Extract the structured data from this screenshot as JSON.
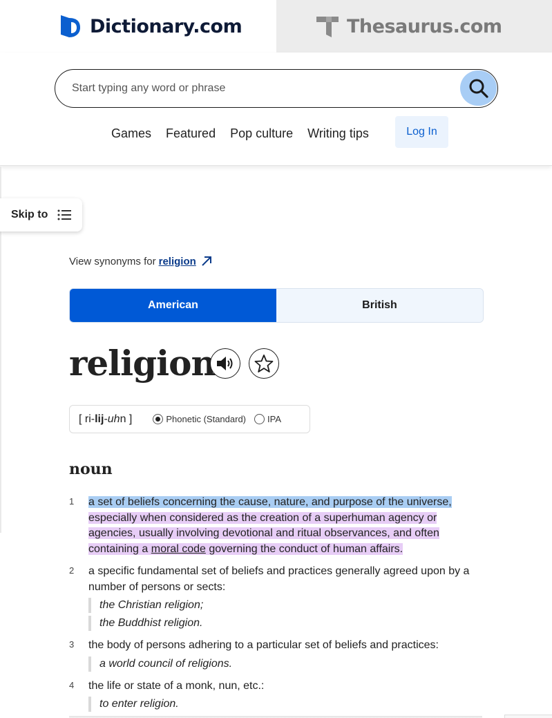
{
  "tabs": {
    "dictionary": "Dictionary.com",
    "thesaurus": "Thesaurus.com"
  },
  "search": {
    "placeholder": "Start typing any word or phrase"
  },
  "nav": {
    "items": [
      "Games",
      "Featured",
      "Pop culture",
      "Writing tips"
    ],
    "login": "Log In"
  },
  "skip": {
    "label": "Skip to"
  },
  "synonyms": {
    "prefix": "View synonyms for",
    "word": "religion"
  },
  "dialect": {
    "american": "American",
    "british": "British",
    "selected": "American"
  },
  "entry": {
    "headword": "religion",
    "pron_open": "[ ri-",
    "pron_stress": "lij",
    "pron_dash": "-",
    "pron_ital": "uh",
    "pron_close": "n ]",
    "phonetic_label": "Phonetic (Standard)",
    "ipa_label": "IPA",
    "pos": "noun"
  },
  "definitions": [
    {
      "num": "1",
      "part1": "a set of beliefs concerning the cause, nature, and purpose of the universe,",
      "part2": " especially when considered as the creation of a superhuman agency or agencies, usually involving devotional and ritual observances, and often containing a ",
      "link": "moral code",
      "part3": " governing the conduct of human affairs."
    },
    {
      "num": "2",
      "text": "a specific fundamental set of beliefs and practices generally agreed upon by a number of persons or sects:",
      "examples": [
        "the Christian religion;",
        "the Buddhist religion."
      ]
    },
    {
      "num": "3",
      "text": "the body of persons adhering to a particular set of beliefs and practices:",
      "examples": [
        "a world council of religions."
      ]
    },
    {
      "num": "4",
      "text": "the life or state of a monk, nun, etc.:",
      "examples": [
        "to enter religion."
      ]
    }
  ],
  "colors": {
    "accent": "#0059d6",
    "highlight_blue": "#a9cdf3",
    "highlight_purple": "#e7cdf6"
  }
}
